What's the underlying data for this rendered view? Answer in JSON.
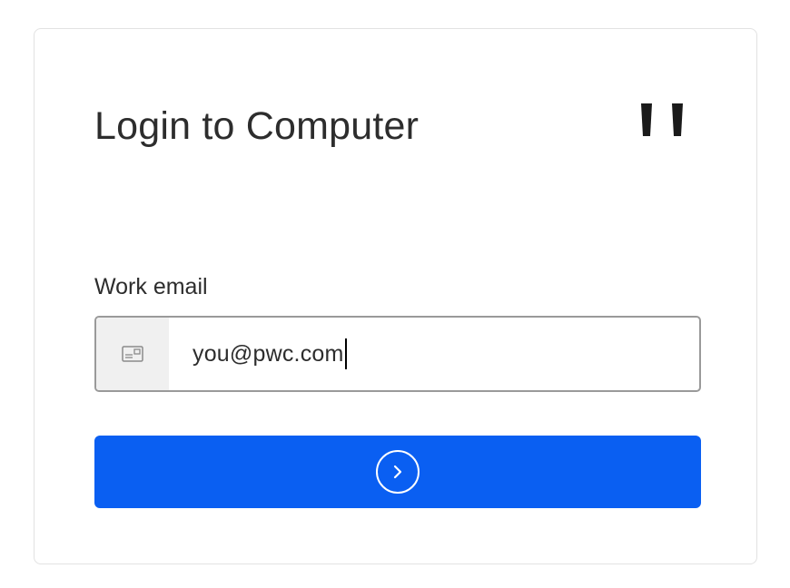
{
  "login": {
    "title": "Login to Computer",
    "email_label": "Work email",
    "email_value": "you@pwc.com",
    "email_icon": "id-card-icon",
    "submit_icon": "arrow-circle-right-icon",
    "logo": "brand-logo-icon"
  },
  "colors": {
    "button": "#0a5ff2",
    "border": "#9a9a9a",
    "icon_bg": "#f0f0f0",
    "text": "#2d2d2d"
  }
}
